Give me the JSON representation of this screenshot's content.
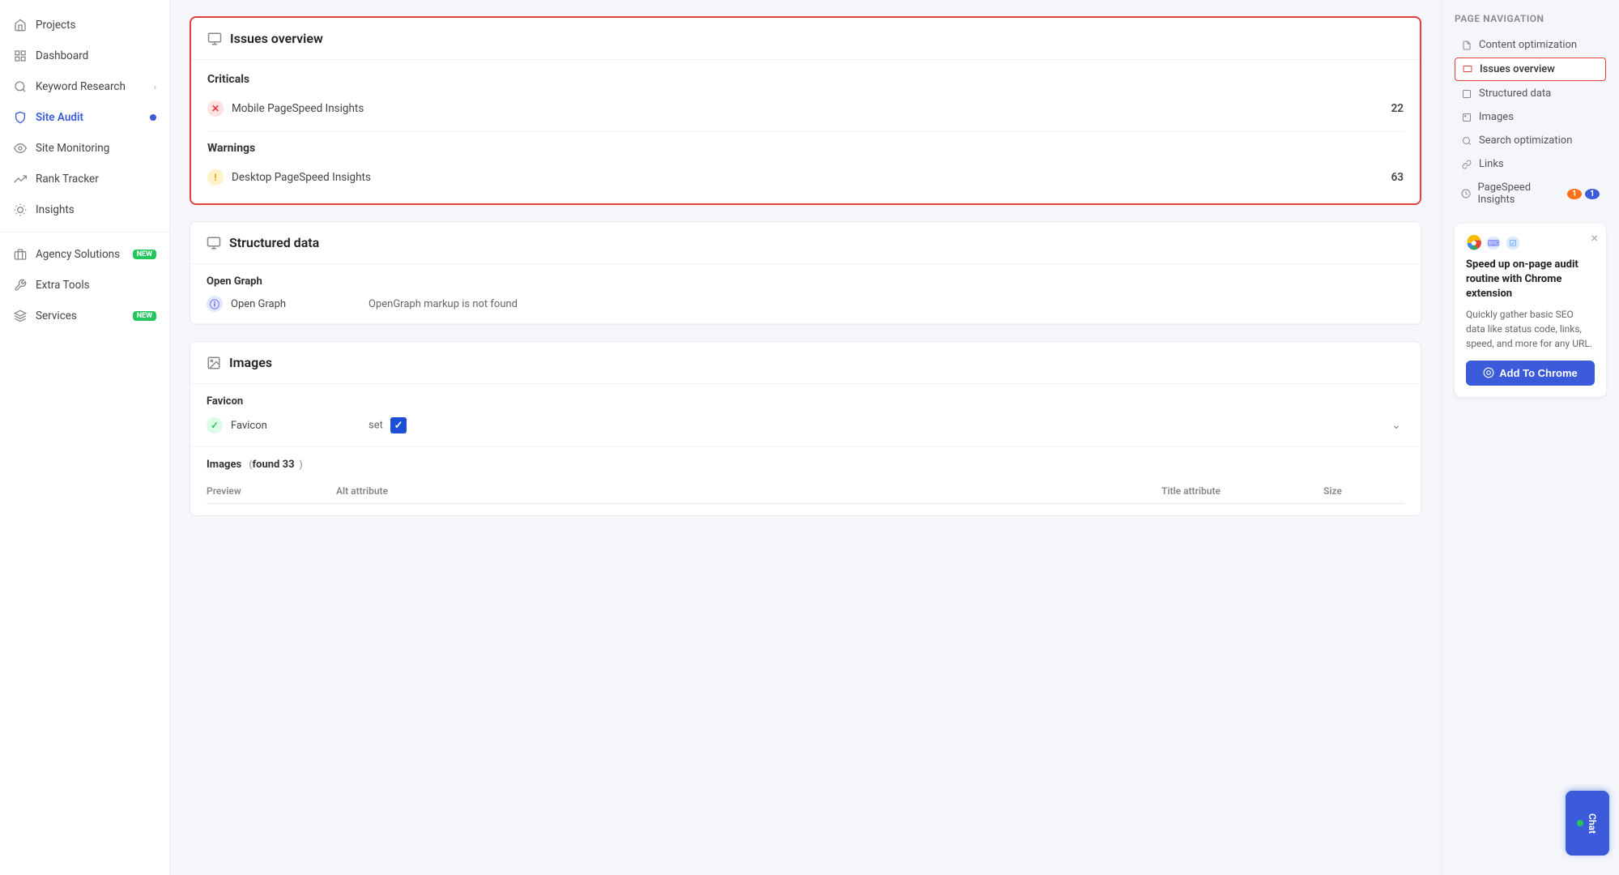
{
  "sidebar": {
    "items": [
      {
        "id": "projects",
        "label": "Projects",
        "icon": "home"
      },
      {
        "id": "dashboard",
        "label": "Dashboard",
        "icon": "grid"
      },
      {
        "id": "keyword-research",
        "label": "Keyword Research",
        "icon": "search",
        "hasChevron": true
      },
      {
        "id": "site-audit",
        "label": "Site Audit",
        "icon": "shield",
        "hasBadge": true
      },
      {
        "id": "site-monitoring",
        "label": "Site Monitoring",
        "icon": "eye"
      },
      {
        "id": "rank-tracker",
        "label": "Rank Tracker",
        "icon": "trending-up"
      },
      {
        "id": "insights",
        "label": "Insights",
        "icon": "lightbulb"
      }
    ],
    "divider": true,
    "bottom_items": [
      {
        "id": "agency-solutions",
        "label": "Agency Solutions",
        "icon": "briefcase",
        "isNew": true
      },
      {
        "id": "extra-tools",
        "label": "Extra Tools",
        "icon": "tool"
      },
      {
        "id": "services",
        "label": "Services",
        "icon": "layers",
        "isNew": true
      }
    ]
  },
  "page_nav": {
    "title": "Page navigation",
    "items": [
      {
        "id": "content-optimization",
        "label": "Content optimization",
        "active": false
      },
      {
        "id": "issues-overview",
        "label": "Issues overview",
        "active": true
      },
      {
        "id": "structured-data",
        "label": "Structured data",
        "active": false
      },
      {
        "id": "images",
        "label": "Images",
        "active": false
      },
      {
        "id": "search-optimization",
        "label": "Search optimization",
        "active": false
      },
      {
        "id": "links",
        "label": "Links",
        "active": false
      },
      {
        "id": "pagespeed-insights",
        "label": "PageSpeed Insights",
        "active": false,
        "badge1": "1",
        "badge2": "1"
      }
    ]
  },
  "chrome_promo": {
    "title": "Speed up on-page audit routine with Chrome extension",
    "description": "Quickly gather basic SEO data like status code, links, speed, and more for any URL.",
    "button_label": "Add To Chrome"
  },
  "issues_overview": {
    "section_title": "Issues overview",
    "criticals_title": "Criticals",
    "criticals": [
      {
        "label": "Mobile PageSpeed Insights",
        "count": "22",
        "status": "error"
      }
    ],
    "warnings_title": "Warnings",
    "warnings": [
      {
        "label": "Desktop PageSpeed Insights",
        "count": "63",
        "status": "warn"
      }
    ]
  },
  "structured_data": {
    "section_title": "Structured data",
    "open_graph": {
      "sub_title": "Open Graph",
      "label": "Open Graph",
      "value": "OpenGraph markup is not found",
      "status": "info"
    }
  },
  "images_section": {
    "section_title": "Images",
    "favicon": {
      "sub_title": "Favicon",
      "label": "Favicon",
      "value": "set",
      "status": "ok"
    },
    "images_table": {
      "sub_title": "Images",
      "found_count": "found 33",
      "columns": [
        {
          "id": "preview",
          "label": "Preview"
        },
        {
          "id": "alt",
          "label": "Alt attribute"
        },
        {
          "id": "title",
          "label": "Title attribute"
        },
        {
          "id": "size",
          "label": "Size"
        }
      ]
    }
  },
  "chat_button": {
    "label": "Chat"
  }
}
